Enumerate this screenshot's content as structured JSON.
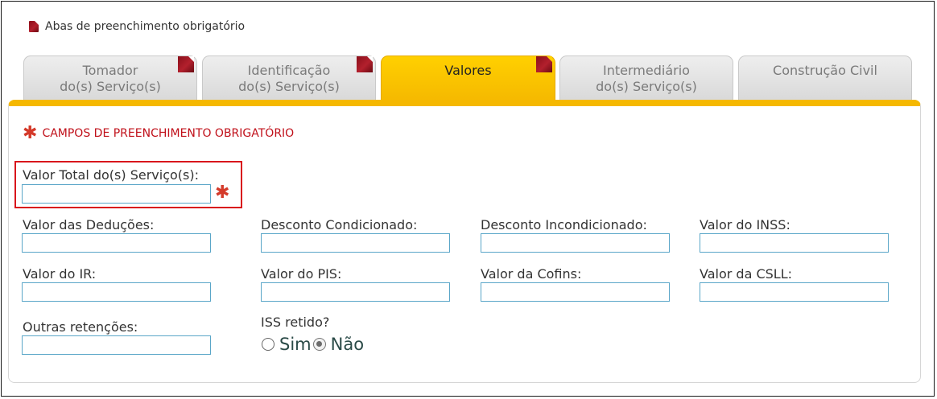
{
  "legend": {
    "label": "Abas de preenchimento obrigatório"
  },
  "tabs": [
    {
      "line1": "Tomador",
      "line2": "do(s) Serviço(s)",
      "required": true,
      "active": false
    },
    {
      "line1": "Identificação",
      "line2": "do(s) Serviço(s)",
      "required": true,
      "active": false
    },
    {
      "line1": "Valores",
      "line2": "",
      "required": true,
      "active": true
    },
    {
      "line1": "Intermediário",
      "line2": "do(s) Serviço(s)",
      "required": false,
      "active": false
    },
    {
      "line1": "Construção Civil",
      "line2": "",
      "required": false,
      "active": false
    }
  ],
  "form": {
    "required_note": "CAMPOS DE PREENCHIMENTO OBRIGATÓRIO",
    "valor_total": {
      "label": "Valor Total do(s) Serviço(s):",
      "value": ""
    },
    "valor_deducoes": {
      "label": "Valor das Deduções:",
      "value": ""
    },
    "desconto_condicionado": {
      "label": "Desconto Condicionado:",
      "value": ""
    },
    "desconto_incondicionado": {
      "label": "Desconto Incondicionado:",
      "value": ""
    },
    "valor_inss": {
      "label": "Valor do INSS:",
      "value": ""
    },
    "valor_ir": {
      "label": "Valor do IR:",
      "value": ""
    },
    "valor_pis": {
      "label": "Valor do PIS:",
      "value": ""
    },
    "valor_cofins": {
      "label": "Valor da Cofins:",
      "value": ""
    },
    "valor_csll": {
      "label": "Valor da CSLL:",
      "value": ""
    },
    "outras_retencoes": {
      "label": "Outras retenções:",
      "value": ""
    },
    "iss_retido": {
      "label": "ISS retido?",
      "option_sim": "Sim",
      "option_nao": "Não",
      "selected": "Não"
    }
  },
  "colors": {
    "accent": "#f5b800",
    "required": "#c0101a",
    "highlight": "#d9141c",
    "input_border": "#5aa6c8"
  }
}
